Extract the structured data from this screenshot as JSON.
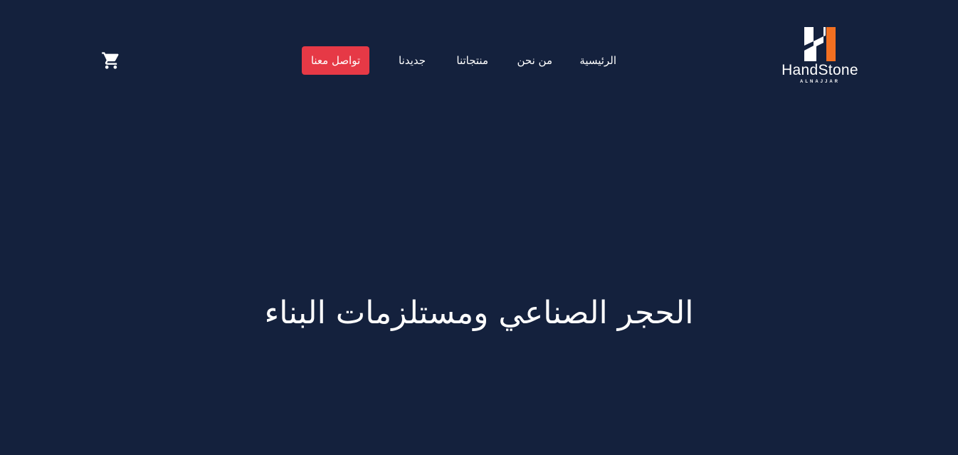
{
  "logo": {
    "wordmark": "HandStone",
    "subtitle": "ALNAJJAR",
    "colors": {
      "white": "#ffffff",
      "orange": "#f37021"
    }
  },
  "nav": {
    "items": [
      {
        "label": "الرئيسية"
      },
      {
        "label": "من نحن"
      },
      {
        "label": "منتجاتنا"
      },
      {
        "label": "جديدنا"
      }
    ],
    "contact_label": "تواصل معنا"
  },
  "cart": {
    "icon": "shopping-cart-icon"
  },
  "hero": {
    "title": "الحجر الصناعي ومستلزمات البناء"
  },
  "colors": {
    "background": "#14213d",
    "accent": "#e63946",
    "text": "#ffffff"
  }
}
